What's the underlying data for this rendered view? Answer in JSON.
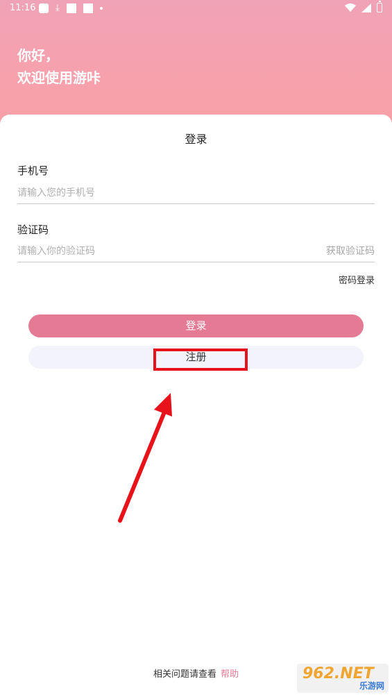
{
  "status_bar": {
    "time": "11:16"
  },
  "header": {
    "greeting_line1": "你好，",
    "greeting_line2": "欢迎使用游咔"
  },
  "login_card": {
    "title": "登录",
    "phone_label": "手机号",
    "phone_placeholder": "请输入您的手机号",
    "code_label": "验证码",
    "code_placeholder": "请输入你的验证码",
    "get_code": "获取验证码",
    "password_login": "密码登录",
    "login_button": "登录",
    "register_button": "注册"
  },
  "footer": {
    "text": "相关问题请查看",
    "help_link": "帮助"
  },
  "watermark": {
    "top": "962.NET",
    "bottom": "乐游网"
  },
  "colors": {
    "accent": "#e57a95",
    "annotation": "#e8121b"
  }
}
